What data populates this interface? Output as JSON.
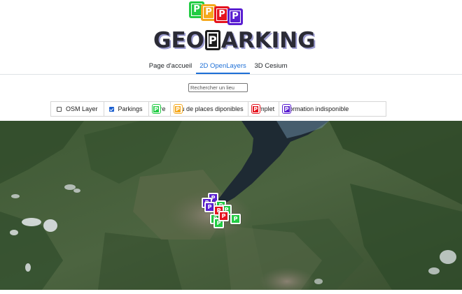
{
  "colors": {
    "libre": "#22cc44",
    "peu": "#f5a81c",
    "complet": "#e5141f",
    "indispo": "#5a1fd1",
    "accent": "#1d6fd6"
  },
  "logo": {
    "title_left": "GEO",
    "title_p": "P",
    "title_right": "ARKING",
    "icon_letter": "P"
  },
  "tabs": [
    {
      "label": "Page d'accueil",
      "active": false
    },
    {
      "label": "2D OpenLayers",
      "active": true
    },
    {
      "label": "3D Cesium",
      "active": false
    }
  ],
  "search": {
    "placeholder": "Rechercher un lieu",
    "value": ""
  },
  "layers": {
    "osm": {
      "label": "OSM Layer",
      "checked": false
    },
    "parkings": {
      "label": "Parkings",
      "checked": true
    }
  },
  "legend": [
    {
      "label": "Libre",
      "status": "libre",
      "icon": "P"
    },
    {
      "label": "Peu de places diponibles",
      "status": "peu",
      "icon": "P"
    },
    {
      "label": "Complet",
      "status": "complet",
      "icon": "P"
    },
    {
      "label": "Information indisponible",
      "status": "indispo",
      "icon": "P"
    }
  ]
}
